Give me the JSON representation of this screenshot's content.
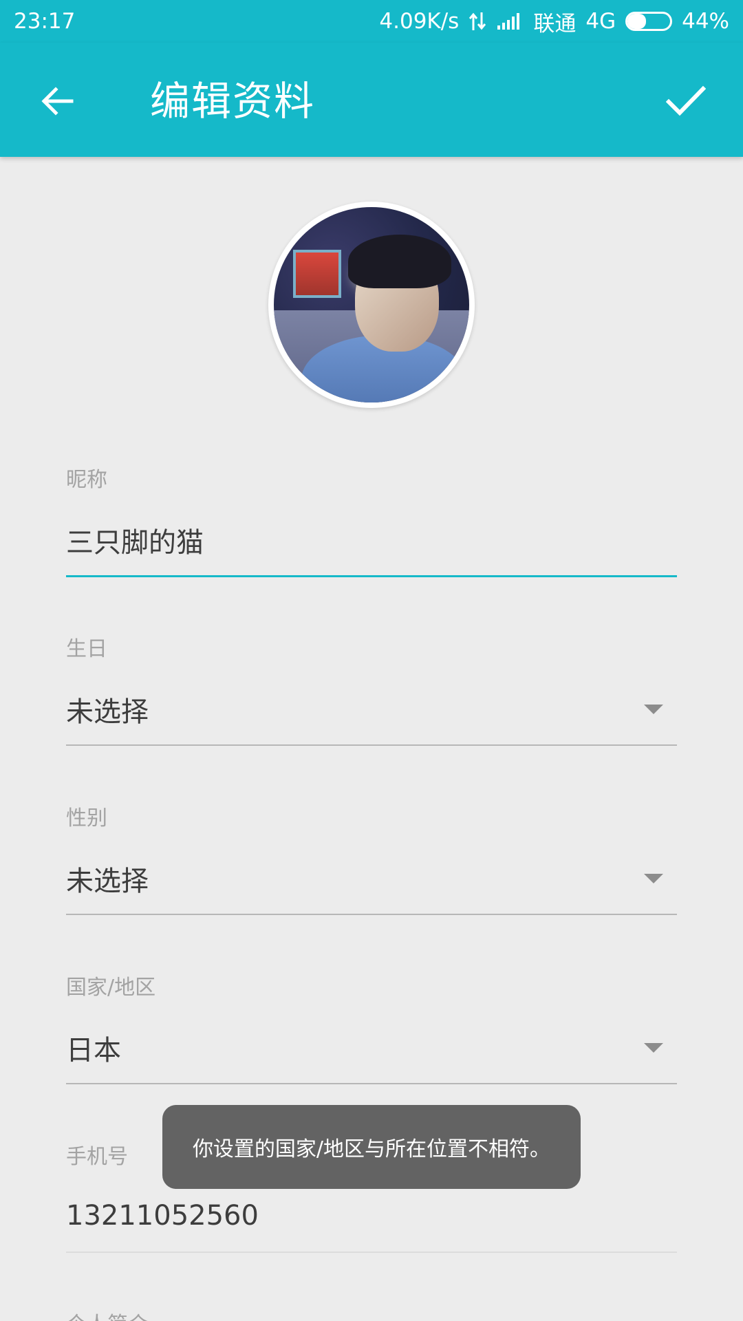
{
  "status_bar": {
    "time": "23:17",
    "speed": "4.09K/s",
    "carrier": "联通",
    "network": "4G",
    "battery": "44%",
    "battery_level": 0.44
  },
  "app_bar": {
    "title": "编辑资料",
    "back_icon": "back-arrow-icon",
    "confirm_icon": "checkmark-icon",
    "color": "#15b9c9"
  },
  "avatar": {
    "alt": "profile-photo"
  },
  "form": {
    "nickname": {
      "label": "昵称",
      "value": "三只脚的猫"
    },
    "birthday": {
      "label": "生日",
      "value": "未选择"
    },
    "gender": {
      "label": "性别",
      "value": "未选择"
    },
    "region": {
      "label": "国家/地区",
      "value": "日本"
    },
    "phone": {
      "label": "手机号",
      "value": "13211052560"
    },
    "bio": {
      "label": "个人简介"
    }
  },
  "toast": {
    "message": "你设置的国家/地区与所在位置不相符。"
  }
}
